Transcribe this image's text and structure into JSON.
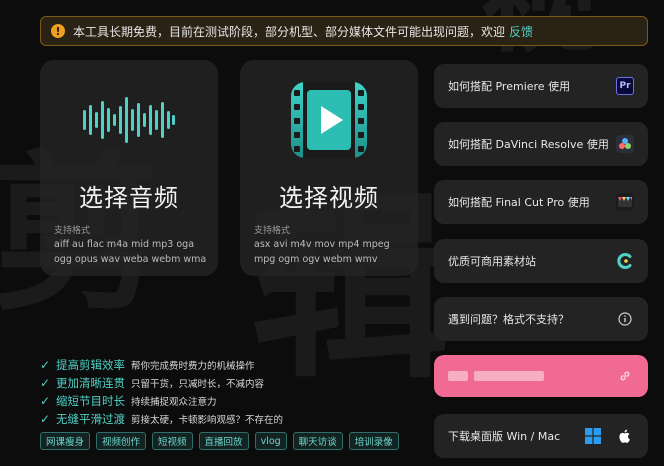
{
  "notice": {
    "text": "本工具长期免费，目前在测试阶段，部分机型、部分媒体文件可能出现问题，欢迎",
    "link": "反馈"
  },
  "audio_card": {
    "title": "选择音频",
    "formats_label": "支持格式",
    "formats": "aiff au flac m4a mid mp3 oga ogg opus wav weba webm wma"
  },
  "video_card": {
    "title": "选择视频",
    "formats_label": "支持格式",
    "formats": "asx avi m4v mov mp4 mpeg mpg ogm ogv webm wmv"
  },
  "features": [
    {
      "name": "提高剪辑效率",
      "desc": "帮你完成费时费力的机械操作"
    },
    {
      "name": "更加清晰连贯",
      "desc": "只留干货，只减时长，不减内容"
    },
    {
      "name": "缩短节目时长",
      "desc": "持续捕捉观众注意力"
    },
    {
      "name": "无缝平滑过渡",
      "desc": "剪接太硬，卡顿影响观感？不存在的"
    }
  ],
  "tags": [
    "网课瘦身",
    "视频创作",
    "短视频",
    "直播回放",
    "vlog",
    "聊天访谈",
    "培训录像"
  ],
  "menu": {
    "premiere": "如何搭配 Premiere 使用",
    "davinci": "如何搭配 DaVinci Resolve 使用",
    "finalcut": "如何搭配 Final Cut Pro 使用",
    "assets": "优质可商用素材站",
    "help": "遇到问题？格式不支持？",
    "download": "下载桌面版 Win / Mac"
  },
  "colors": {
    "accent": "#4fd1c5",
    "pink": "#f06a94",
    "warning": "#f0a020"
  },
  "icons": {
    "premiere": "Pr"
  }
}
